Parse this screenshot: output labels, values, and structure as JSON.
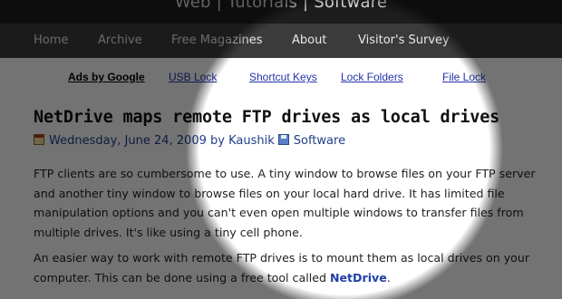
{
  "header": {
    "tagline": "Web | Tutorials | Software"
  },
  "nav": {
    "items": [
      {
        "label": "Home"
      },
      {
        "label": "Archive"
      },
      {
        "label": "Free Magazines"
      },
      {
        "label": "About"
      },
      {
        "label": "Visitor's Survey"
      }
    ]
  },
  "ads": {
    "label": "Ads by Google",
    "links": [
      {
        "label": "USB Lock"
      },
      {
        "label": "Shortcut Keys"
      },
      {
        "label": "Lock Folders"
      },
      {
        "label": "File Lock"
      }
    ]
  },
  "article": {
    "title": "NetDrive maps remote FTP drives as local drives",
    "date": "Wednesday, June 24, 2009",
    "by": "by",
    "author": "Kaushik",
    "category": "Software",
    "icons": {
      "date": "calendar-icon",
      "category": "floppy-disk-icon"
    },
    "p1": "FTP clients are so cumbersome to use. A tiny window to browse files on your FTP server and another tiny window to browse files on your local hard drive. It has limited file manipulation options and you can't even open multiple windows to transfer files from multiple drives. It's like using a tiny cell phone.",
    "p2_prefix": "An easier way to work with remote FTP drives is to mount them as local drives on your computer. This can be done using a free tool called ",
    "p2_link": "NetDrive",
    "p2_suffix": "."
  },
  "colors": {
    "header_bg": "#1d1d1d",
    "nav_bg": "#3b3b3b",
    "link": "#2233aa",
    "meta": "#1f3f8a"
  }
}
